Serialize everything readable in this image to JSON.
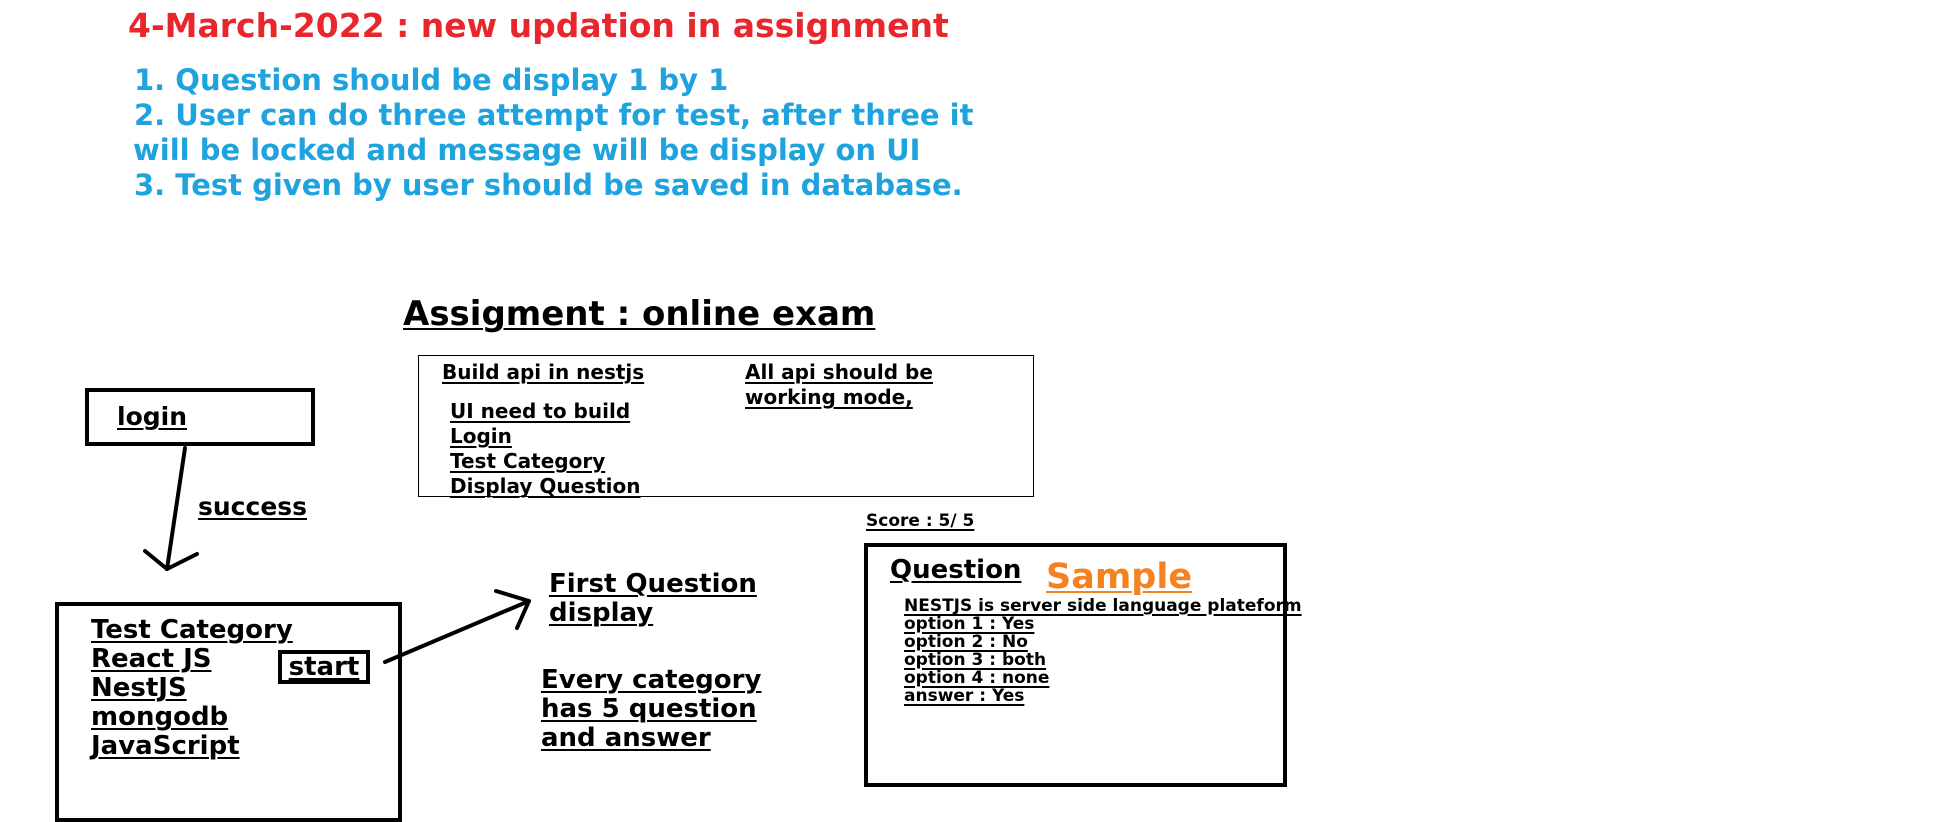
{
  "update": {
    "title": "4-March-2022 : new updation in assignment",
    "items": [
      "1. Question should be display 1 by 1",
      "2. User can do three attempt for test, after three it",
      "will be locked and message will be display on UI",
      "3. Test given by user should be saved in database."
    ]
  },
  "assignment": {
    "title": "Assigment : online exam",
    "build_api": "Build api in nestjs",
    "api_note_line1": "All api should be",
    "api_note_line2": "working mode,",
    "ui_list": [
      "UI need to build",
      "Login",
      "Test Category",
      "Display Question"
    ]
  },
  "flow": {
    "login_label": "login",
    "success_label": "success",
    "category_list": [
      "Test Category",
      "React JS",
      "NestJS",
      "mongodb",
      "JavaScript"
    ],
    "start_label": "start",
    "first_question_line1": "First Question",
    "first_question_line2": "display",
    "every_category_lines": [
      "Every category",
      "has 5 question",
      "and answer"
    ]
  },
  "question_panel": {
    "score": "Score : 5/ 5",
    "heading": "Question",
    "sample": "Sample",
    "question_text": "NESTJS is server side language plateform",
    "options": [
      "option 1 : Yes",
      "option 2 : No",
      "option 3 : both",
      "option 4 : none"
    ],
    "answer": "answer : Yes"
  },
  "colors": {
    "title_red": "#e8262c",
    "requirement_blue": "#1fa3de",
    "sample_orange": "#f58220"
  }
}
